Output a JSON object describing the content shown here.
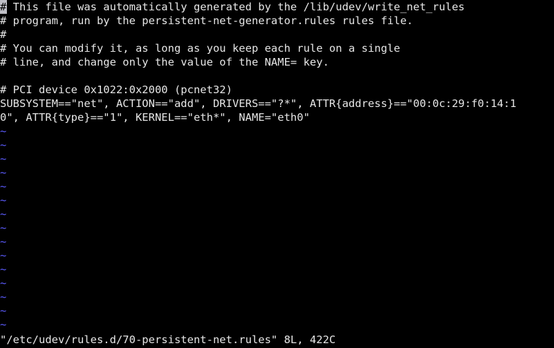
{
  "terminal": {
    "title": "vim-terminal",
    "background_color": "#000000",
    "foreground_color": "#e6e6e6",
    "tilde_color": "#5c5cff",
    "cursor_color": "#bfbfc6",
    "columns": 80,
    "rows": 25
  },
  "editor": {
    "name": "vim",
    "cursor": {
      "row": 0,
      "column": 0,
      "char": "#"
    },
    "buffer_lines": [
      "# This file was automatically generated by the /lib/udev/write_net_rules",
      "# program, run by the persistent-net-generator.rules rules file.",
      "#",
      "# You can modify it, as long as you keep each rule on a single",
      "# line, and change only the value of the NAME= key.",
      "",
      "# PCI device 0x1022:0x2000 (pcnet32)",
      "SUBSYSTEM==\"net\", ACTION==\"add\", DRIVERS==\"?*\", ATTR{address}==\"00:0c:29:f0:14:1",
      "0\", ATTR{type}==\"1\", KERNEL==\"eth*\", NAME=\"eth0\""
    ],
    "empty_marker": "~",
    "empty_marker_count": 15,
    "status_line": "\"/etc/udev/rules.d/70-persistent-net.rules\" 8L, 422C",
    "file_path": "/etc/udev/rules.d/70-persistent-net.rules",
    "line_count": "8L",
    "char_count": "422C"
  }
}
